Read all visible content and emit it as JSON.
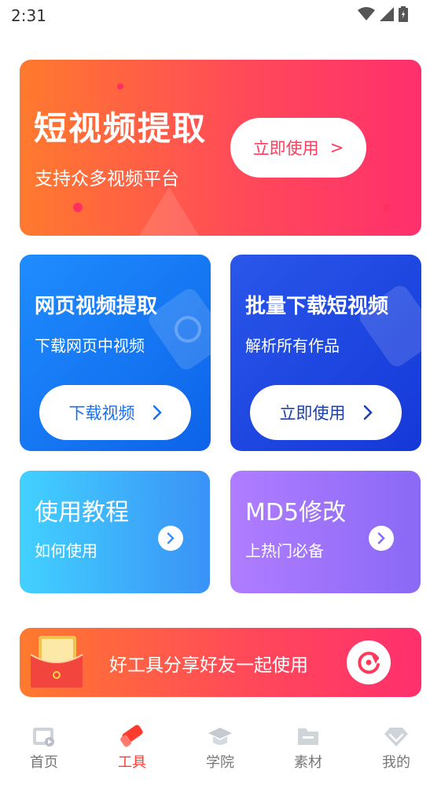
{
  "status": {
    "time": "2:31"
  },
  "hero": {
    "title": "短视频提取",
    "subtitle": "支持众多视频平台",
    "button_label": "立即使用",
    "button_arrow": ">"
  },
  "web_card": {
    "title": "网页视频提取",
    "subtitle": "下载网页中视频",
    "button_label": "下载视频"
  },
  "batch_card": {
    "title": "批量下载短视频",
    "subtitle": "解析所有作品",
    "button_label": "立即使用"
  },
  "tutorial_card": {
    "title": "使用教程",
    "subtitle": "如何使用"
  },
  "md5_card": {
    "title": "MD5修改",
    "subtitle": "上热门必备"
  },
  "share_banner": {
    "text": "好工具分享好友一起使用"
  },
  "tabbar": {
    "items": [
      {
        "label": "首页",
        "icon": "home-icon",
        "active": false
      },
      {
        "label": "工具",
        "icon": "tool-icon",
        "active": true
      },
      {
        "label": "学院",
        "icon": "graduation-cap-icon",
        "active": false
      },
      {
        "label": "素材",
        "icon": "folder-icon",
        "active": false
      },
      {
        "label": "我的",
        "icon": "diamond-icon",
        "active": false
      }
    ]
  },
  "colors": {
    "accent": "#ff3b30",
    "hero_start": "#ff7a2e",
    "hero_end": "#ff2f6d",
    "web_blue": "#1f8dff",
    "batch_blue": "#1438d8"
  }
}
